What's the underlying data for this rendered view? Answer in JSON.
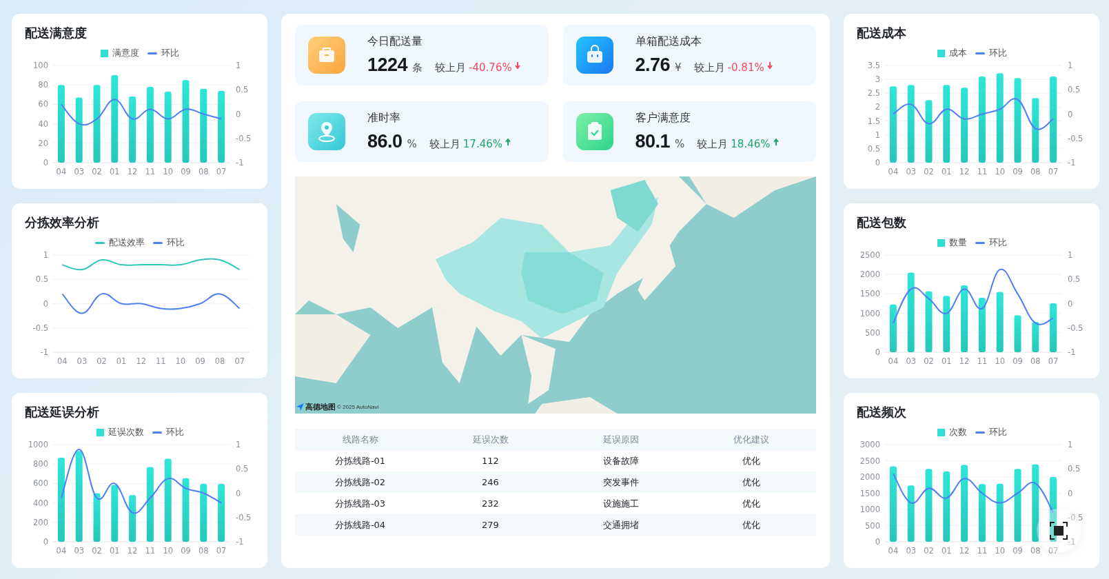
{
  "left_panels": [
    {
      "title": "配送满意度",
      "chart_data": {
        "type": "bar",
        "categories": [
          "04",
          "03",
          "02",
          "01",
          "12",
          "11",
          "10",
          "09",
          "08",
          "07"
        ],
        "series": [
          {
            "name": "满意度",
            "color": "#2ee0d3",
            "values": [
              80,
              67,
              80,
              90,
              68,
              78,
              73,
              85,
              76,
              74
            ]
          },
          {
            "name": "环比",
            "type": "line",
            "axis": "y2",
            "color": "#4f7ff5",
            "values": [
              0.2,
              -0.2,
              -0.1,
              0.3,
              -0.1,
              0.1,
              -0.1,
              0.1,
              0.0,
              -0.1
            ]
          }
        ],
        "ylim": [
          0,
          100
        ],
        "grid": true,
        "legend": "top",
        "yticks": [
          0,
          20,
          40,
          60,
          80,
          100
        ],
        "y2lim": [
          -1,
          1
        ],
        "y2ticks": [
          -1,
          -0.5,
          0,
          0.5,
          1
        ]
      }
    },
    {
      "title": "分拣效率分析",
      "chart_data": {
        "type": "line",
        "categories": [
          "04",
          "03",
          "02",
          "01",
          "12",
          "11",
          "10",
          "09",
          "08",
          "07"
        ],
        "series": [
          {
            "name": "配送效率",
            "color": "#2cc9bb",
            "values": [
              0.8,
              0.7,
              0.9,
              0.8,
              0.8,
              0.8,
              0.8,
              0.9,
              0.9,
              0.7
            ]
          },
          {
            "name": "环比",
            "color": "#4f7ff5",
            "values": [
              0.2,
              -0.2,
              0.2,
              0.0,
              0.0,
              -0.1,
              -0.1,
              0.0,
              0.2,
              -0.1
            ]
          }
        ],
        "ylim": [
          -1,
          1
        ],
        "grid": true,
        "legend": "top",
        "yticks": [
          -1,
          -0.5,
          0,
          0.5,
          1
        ]
      }
    },
    {
      "title": "配送延误分析",
      "chart_data": {
        "type": "bar",
        "categories": [
          "04",
          "03",
          "02",
          "01",
          "12",
          "11",
          "10",
          "09",
          "08",
          "07"
        ],
        "series": [
          {
            "name": "延误次数",
            "color": "#2ee0d3",
            "values": [
              865,
              935,
              500,
              585,
              480,
              770,
              855,
              655,
              595,
              595
            ]
          },
          {
            "name": "环比",
            "type": "line",
            "axis": "y2",
            "color": "#4f7ff5",
            "values": [
              -0.1,
              0.9,
              -0.1,
              0.2,
              -0.4,
              -0.1,
              0.3,
              0.1,
              0.0,
              -0.2
            ]
          }
        ],
        "ylim": [
          0,
          1000
        ],
        "grid": true,
        "legend": "top",
        "yticks": [
          0,
          200,
          400,
          600,
          800,
          1000
        ],
        "y2lim": [
          -1,
          1
        ],
        "y2ticks": [
          -1,
          -0.5,
          0,
          0.5,
          1
        ]
      }
    }
  ],
  "kpis": [
    {
      "label": "今日配送量",
      "value": "1224",
      "unit": "条",
      "compare_label": "较上月",
      "change": "-40.76%",
      "kind": "down"
    },
    {
      "label": "单箱配送成本",
      "value": "2.76",
      "unit": "¥",
      "compare_label": "较上月",
      "change": "-0.81%",
      "kind": "down"
    },
    {
      "label": "准时率",
      "value": "86.0",
      "unit": "%",
      "compare_label": "较上月",
      "change": "17.46%",
      "kind": "up"
    },
    {
      "label": "客户满意度",
      "value": "80.1",
      "unit": "%",
      "compare_label": "较上月",
      "change": "18.46%",
      "kind": "up"
    }
  ],
  "map": {
    "kind": "picture",
    "logo": "高德地图",
    "attribution": "© 2025 AutoNavi"
  },
  "table": {
    "columns": [
      "线路名称",
      "延误次数",
      "延误原因",
      "优化建议"
    ],
    "rows": [
      {
        "cells": [
          "分拣线路-01",
          "112",
          "设备故障",
          "优化"
        ]
      },
      {
        "cells": [
          "分拣线路-02",
          "246",
          "突发事件",
          "优化"
        ]
      },
      {
        "cells": [
          "分拣线路-03",
          "232",
          "设施施工",
          "优化"
        ]
      },
      {
        "cells": [
          "分拣线路-04",
          "279",
          "交通拥堵",
          "优化"
        ]
      }
    ]
  },
  "right_panels": [
    {
      "title": "配送成本",
      "chart_data": {
        "type": "bar",
        "categories": [
          "04",
          "03",
          "02",
          "01",
          "12",
          "11",
          "10",
          "09",
          "08",
          "07"
        ],
        "series": [
          {
            "name": "成本",
            "color": "#2ee0d3",
            "values": [
              2.75,
              2.8,
              2.25,
              2.8,
              2.7,
              3.1,
              3.22,
              3.05,
              2.33,
              3.1
            ]
          },
          {
            "name": "环比",
            "type": "line",
            "axis": "y2",
            "color": "#4f7ff5",
            "values": [
              0.0,
              0.2,
              -0.2,
              0.1,
              -0.1,
              0.0,
              0.1,
              0.3,
              -0.3,
              -0.1
            ]
          }
        ],
        "ylim": [
          0,
          3.5
        ],
        "grid": true,
        "legend": "top",
        "yticks": [
          0,
          0.5,
          1,
          1.5,
          2,
          2.5,
          3,
          3.5
        ],
        "y2lim": [
          -1,
          1
        ],
        "y2ticks": [
          -1,
          -0.5,
          0,
          0.5,
          1
        ]
      }
    },
    {
      "title": "配送包数",
      "chart_data": {
        "type": "bar",
        "categories": [
          "04",
          "03",
          "02",
          "01",
          "12",
          "11",
          "10",
          "09",
          "08",
          "07"
        ],
        "series": [
          {
            "name": "数量",
            "color": "#2ee0d3",
            "values": [
              1230,
              2050,
              1570,
              1450,
              1720,
              1400,
              1550,
              950,
              780,
              1260
            ]
          },
          {
            "name": "环比",
            "type": "line",
            "axis": "y2",
            "color": "#4f7ff5",
            "values": [
              -0.4,
              0.3,
              0.1,
              -0.2,
              0.3,
              -0.1,
              0.7,
              0.2,
              -0.4,
              -0.3
            ]
          }
        ],
        "ylim": [
          0,
          2500
        ],
        "grid": true,
        "legend": "top",
        "yticks": [
          0,
          500,
          1000,
          1500,
          2000,
          2500
        ],
        "y2lim": [
          -1,
          1
        ],
        "y2ticks": [
          -1,
          -0.5,
          0,
          0.5,
          1
        ]
      }
    },
    {
      "title": "配送频次",
      "chart_data": {
        "type": "bar",
        "categories": [
          "04",
          "03",
          "02",
          "01",
          "12",
          "11",
          "10",
          "09",
          "08",
          "07"
        ],
        "series": [
          {
            "name": "次数",
            "color": "#2ee0d3",
            "values": [
              2330,
              1740,
              2250,
              2170,
              2370,
              1780,
              1790,
              2250,
              2390,
              2000
            ]
          },
          {
            "name": "环比",
            "type": "line",
            "axis": "y2",
            "color": "#4f7ff5",
            "values": [
              0.4,
              -0.2,
              0.1,
              -0.1,
              0.3,
              0.0,
              -0.2,
              0.0,
              0.2,
              -0.4
            ]
          }
        ],
        "ylim": [
          0,
          3000
        ],
        "grid": true,
        "legend": "top",
        "yticks": [
          0,
          500,
          1000,
          1500,
          2000,
          2500,
          3000
        ],
        "y2lim": [
          -1,
          1
        ],
        "y2ticks": [
          -1,
          -0.5,
          0,
          0.5,
          1
        ]
      }
    }
  ]
}
